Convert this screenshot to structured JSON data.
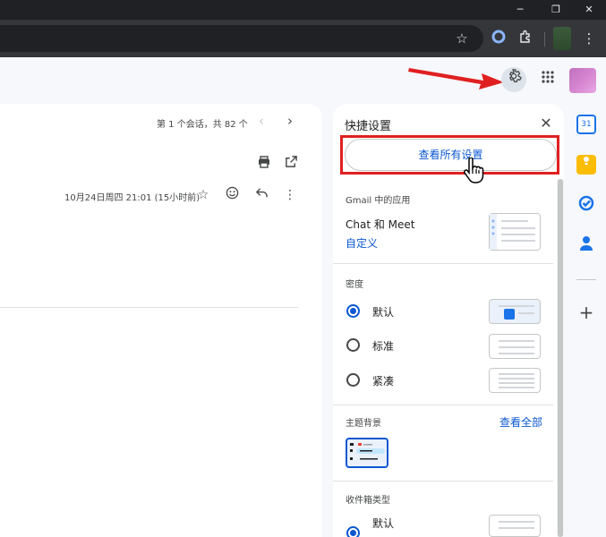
{
  "window": {
    "minimize": "─",
    "restore": "❐",
    "close": "✕"
  },
  "browser": {
    "star_icon": "☆",
    "extension_icon": "puzzle",
    "menu_icon": "⋮"
  },
  "gmail": {
    "settings_icon": "gear-icon",
    "apps_icon": "grid-icon"
  },
  "conversation": {
    "pager": "第 1 个会话，共 82 个",
    "date": "10月24日周四 21:01 (15小时前)"
  },
  "quick_settings": {
    "title": "快捷设置",
    "see_all_label": "查看所有设置",
    "apps_section": "Gmail 中的应用",
    "chat_meet": "Chat 和 Meet",
    "customize": "自定义",
    "density_section": "密度",
    "density_options": [
      {
        "label": "默认",
        "selected": true
      },
      {
        "label": "标准",
        "selected": false
      },
      {
        "label": "紧凑",
        "selected": false
      }
    ],
    "theme_section": "主题背景",
    "theme_view_all": "查看全部",
    "inbox_type_section": "收件箱类型",
    "inbox_default": "默认"
  },
  "colors": {
    "accent": "#0b57d0",
    "highlight": "#e02020"
  }
}
